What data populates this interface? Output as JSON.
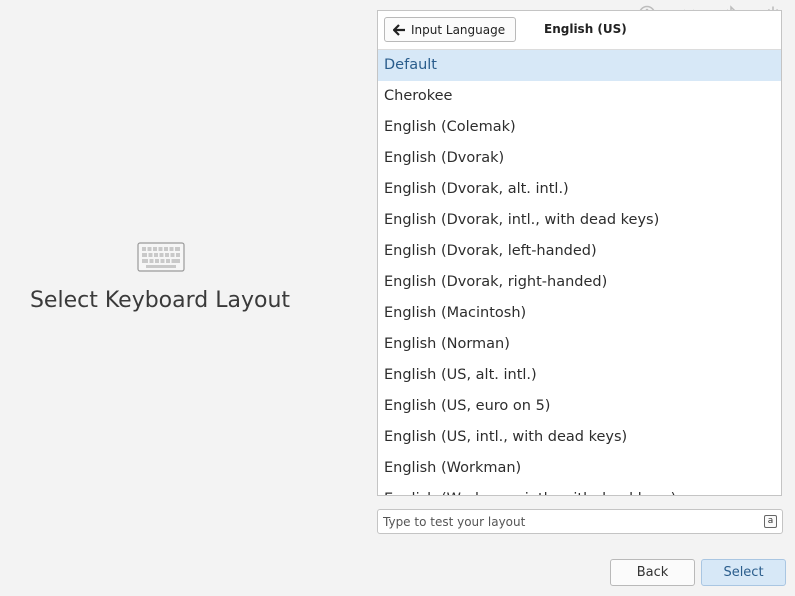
{
  "title": "Select Keyboard Layout",
  "header": {
    "back_label": "Input Language",
    "language": "English (US)"
  },
  "status_icons": [
    "accessibility-icon",
    "network-icon",
    "bluetooth-icon",
    "power-icon"
  ],
  "layouts": [
    "Default",
    "Cherokee",
    "English (Colemak)",
    "English (Dvorak)",
    "English (Dvorak, alt. intl.)",
    "English (Dvorak, intl., with dead keys)",
    "English (Dvorak, left-handed)",
    "English (Dvorak, right-handed)",
    "English (Macintosh)",
    "English (Norman)",
    "English (US, alt. intl.)",
    "English (US, euro on 5)",
    "English (US, intl., with dead keys)",
    "English (Workman)",
    "English (Workman, intl., with dead keys)"
  ],
  "selected_layout": "Default",
  "test_field": {
    "placeholder": "Type to test your layout",
    "indicator": "a"
  },
  "footer": {
    "back_label": "Back",
    "select_label": "Select"
  },
  "colors": {
    "selection_bg": "#d7e8f7",
    "selection_text": "#2a5d8c",
    "window_bg": "#f3f3f3"
  }
}
